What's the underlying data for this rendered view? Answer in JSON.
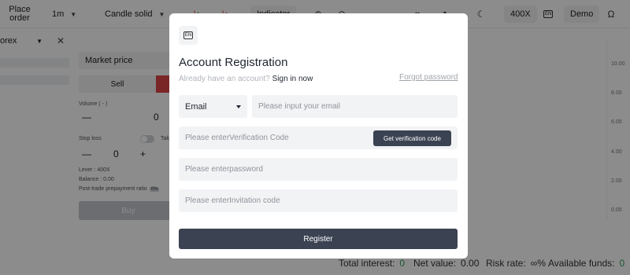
{
  "toolbar": {
    "place_order": "Place order",
    "timeframe": "1m",
    "chart_style": "Candle solid",
    "indicator": "Indicator",
    "leverage": "400X",
    "lang_code": "EN",
    "account_mode": "Demo",
    "icons": [
      "zoom-in-icon",
      "zoom-out-icon",
      "arrow-left-icon",
      "arrow-right-icon",
      "crop-icon",
      "expand-icon",
      "moon-icon",
      "omega-icon"
    ]
  },
  "left_panel": {
    "market": "orex"
  },
  "order_panel": {
    "order_type": "Market price",
    "sell": "Sell",
    "buy": "Buy",
    "volume_label": "Volume ( - )",
    "volume_value": "0",
    "stop_loss_label": "Stop loss",
    "take_label": "Take",
    "stop_loss_value": "0",
    "lever_label": "Lever : 400X",
    "balance_label": "Balance : 0.00",
    "ratio_label": "Post-trade prepayment ratio",
    "ratio_badge": "0%"
  },
  "price_axis": {
    "ticks": [
      "10.00",
      "8.00",
      "6.00",
      "4.00",
      "2.00",
      "0.00"
    ]
  },
  "status_bar": {
    "total_interest_label": "Total interest:",
    "total_interest_value": "0",
    "net_value_label": "Net value:",
    "net_value_value": "0.00",
    "risk_rate_label": "Risk rate:",
    "risk_rate_value": "∞%",
    "available_funds_label": "Available funds:",
    "available_funds_value": "0"
  },
  "modal": {
    "lang_badge": "EN",
    "title": "Account Registration",
    "have_account": "Already have an account?",
    "sign_in": "Sign in now",
    "forgot_password": "Forgot password",
    "account_type": "Email",
    "email_placeholder": "Please input your email",
    "verification_placeholder": "Please enterVerification Code",
    "get_code_button": "Get verification code",
    "password_placeholder": "Please enterpassword",
    "invitation_placeholder": "Please enterInvitation code",
    "register_button": "Register"
  },
  "colors": {
    "accent_dark": "#3b4252",
    "positive": "#2e9e5b",
    "negative": "#e04646",
    "overlay": "rgba(0,0,0,0.45)"
  }
}
